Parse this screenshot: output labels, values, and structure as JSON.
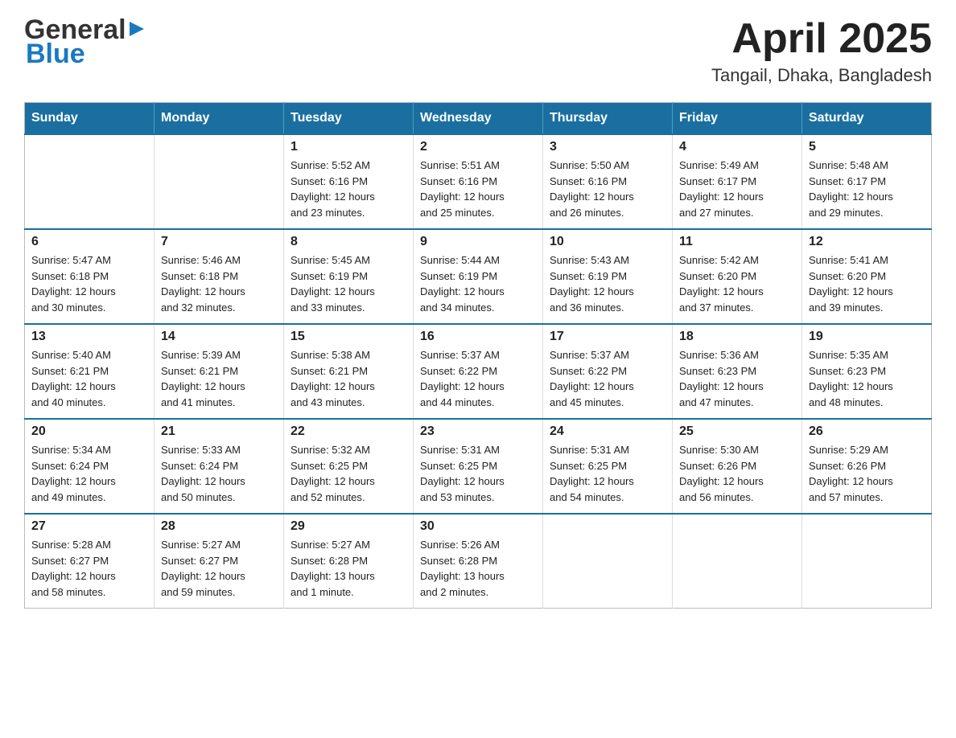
{
  "header": {
    "logo_general": "General",
    "logo_blue": "Blue",
    "month_year": "April 2025",
    "location": "Tangail, Dhaka, Bangladesh"
  },
  "calendar": {
    "days_of_week": [
      "Sunday",
      "Monday",
      "Tuesday",
      "Wednesday",
      "Thursday",
      "Friday",
      "Saturday"
    ],
    "weeks": [
      [
        {
          "day": "",
          "info": ""
        },
        {
          "day": "",
          "info": ""
        },
        {
          "day": "1",
          "info": "Sunrise: 5:52 AM\nSunset: 6:16 PM\nDaylight: 12 hours\nand 23 minutes."
        },
        {
          "day": "2",
          "info": "Sunrise: 5:51 AM\nSunset: 6:16 PM\nDaylight: 12 hours\nand 25 minutes."
        },
        {
          "day": "3",
          "info": "Sunrise: 5:50 AM\nSunset: 6:16 PM\nDaylight: 12 hours\nand 26 minutes."
        },
        {
          "day": "4",
          "info": "Sunrise: 5:49 AM\nSunset: 6:17 PM\nDaylight: 12 hours\nand 27 minutes."
        },
        {
          "day": "5",
          "info": "Sunrise: 5:48 AM\nSunset: 6:17 PM\nDaylight: 12 hours\nand 29 minutes."
        }
      ],
      [
        {
          "day": "6",
          "info": "Sunrise: 5:47 AM\nSunset: 6:18 PM\nDaylight: 12 hours\nand 30 minutes."
        },
        {
          "day": "7",
          "info": "Sunrise: 5:46 AM\nSunset: 6:18 PM\nDaylight: 12 hours\nand 32 minutes."
        },
        {
          "day": "8",
          "info": "Sunrise: 5:45 AM\nSunset: 6:19 PM\nDaylight: 12 hours\nand 33 minutes."
        },
        {
          "day": "9",
          "info": "Sunrise: 5:44 AM\nSunset: 6:19 PM\nDaylight: 12 hours\nand 34 minutes."
        },
        {
          "day": "10",
          "info": "Sunrise: 5:43 AM\nSunset: 6:19 PM\nDaylight: 12 hours\nand 36 minutes."
        },
        {
          "day": "11",
          "info": "Sunrise: 5:42 AM\nSunset: 6:20 PM\nDaylight: 12 hours\nand 37 minutes."
        },
        {
          "day": "12",
          "info": "Sunrise: 5:41 AM\nSunset: 6:20 PM\nDaylight: 12 hours\nand 39 minutes."
        }
      ],
      [
        {
          "day": "13",
          "info": "Sunrise: 5:40 AM\nSunset: 6:21 PM\nDaylight: 12 hours\nand 40 minutes."
        },
        {
          "day": "14",
          "info": "Sunrise: 5:39 AM\nSunset: 6:21 PM\nDaylight: 12 hours\nand 41 minutes."
        },
        {
          "day": "15",
          "info": "Sunrise: 5:38 AM\nSunset: 6:21 PM\nDaylight: 12 hours\nand 43 minutes."
        },
        {
          "day": "16",
          "info": "Sunrise: 5:37 AM\nSunset: 6:22 PM\nDaylight: 12 hours\nand 44 minutes."
        },
        {
          "day": "17",
          "info": "Sunrise: 5:37 AM\nSunset: 6:22 PM\nDaylight: 12 hours\nand 45 minutes."
        },
        {
          "day": "18",
          "info": "Sunrise: 5:36 AM\nSunset: 6:23 PM\nDaylight: 12 hours\nand 47 minutes."
        },
        {
          "day": "19",
          "info": "Sunrise: 5:35 AM\nSunset: 6:23 PM\nDaylight: 12 hours\nand 48 minutes."
        }
      ],
      [
        {
          "day": "20",
          "info": "Sunrise: 5:34 AM\nSunset: 6:24 PM\nDaylight: 12 hours\nand 49 minutes."
        },
        {
          "day": "21",
          "info": "Sunrise: 5:33 AM\nSunset: 6:24 PM\nDaylight: 12 hours\nand 50 minutes."
        },
        {
          "day": "22",
          "info": "Sunrise: 5:32 AM\nSunset: 6:25 PM\nDaylight: 12 hours\nand 52 minutes."
        },
        {
          "day": "23",
          "info": "Sunrise: 5:31 AM\nSunset: 6:25 PM\nDaylight: 12 hours\nand 53 minutes."
        },
        {
          "day": "24",
          "info": "Sunrise: 5:31 AM\nSunset: 6:25 PM\nDaylight: 12 hours\nand 54 minutes."
        },
        {
          "day": "25",
          "info": "Sunrise: 5:30 AM\nSunset: 6:26 PM\nDaylight: 12 hours\nand 56 minutes."
        },
        {
          "day": "26",
          "info": "Sunrise: 5:29 AM\nSunset: 6:26 PM\nDaylight: 12 hours\nand 57 minutes."
        }
      ],
      [
        {
          "day": "27",
          "info": "Sunrise: 5:28 AM\nSunset: 6:27 PM\nDaylight: 12 hours\nand 58 minutes."
        },
        {
          "day": "28",
          "info": "Sunrise: 5:27 AM\nSunset: 6:27 PM\nDaylight: 12 hours\nand 59 minutes."
        },
        {
          "day": "29",
          "info": "Sunrise: 5:27 AM\nSunset: 6:28 PM\nDaylight: 13 hours\nand 1 minute."
        },
        {
          "day": "30",
          "info": "Sunrise: 5:26 AM\nSunset: 6:28 PM\nDaylight: 13 hours\nand 2 minutes."
        },
        {
          "day": "",
          "info": ""
        },
        {
          "day": "",
          "info": ""
        },
        {
          "day": "",
          "info": ""
        }
      ]
    ]
  }
}
